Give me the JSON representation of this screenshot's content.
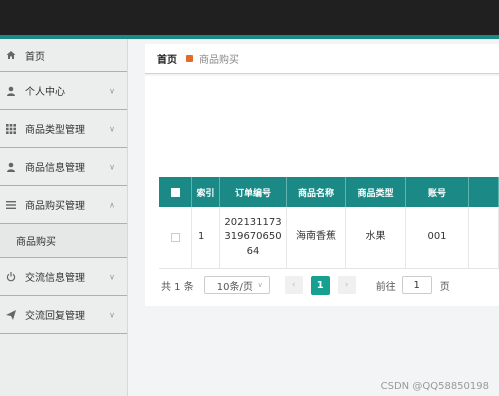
{
  "sidebar": {
    "items": [
      {
        "label": "首页",
        "icon": "home-icon"
      },
      {
        "label": "个人中心",
        "icon": "user-icon"
      },
      {
        "label": "商品类型管理",
        "icon": "grid-icon"
      },
      {
        "label": "商品信息管理",
        "icon": "user-icon"
      },
      {
        "label": "商品购买管理",
        "icon": "list-icon"
      },
      {
        "label": "交流信息管理",
        "icon": "power-icon"
      },
      {
        "label": "交流回复管理",
        "icon": "send-icon"
      }
    ],
    "submenu": {
      "label": "商品购买"
    }
  },
  "breadcrumb": {
    "home": "首页",
    "current": "商品购买"
  },
  "table": {
    "headers": [
      "索引",
      "订单编号",
      "商品名称",
      "商品类型",
      "账号"
    ],
    "rows": [
      {
        "index": "1",
        "order_line1": "202131173",
        "order_line2": "319670650",
        "order_line3": "64",
        "name": "海南香蕉",
        "type": "水果",
        "account": "001"
      }
    ]
  },
  "pager": {
    "total": "共 1 条",
    "page_size": "10条/页",
    "current_page": "1",
    "goto_label": "前往",
    "goto_value": "1",
    "page_unit": "页"
  },
  "watermark": "CSDN @QQ58850198",
  "colors": {
    "accent": "#1b8a86",
    "topbar": "#202020",
    "active_page": "#17a090"
  }
}
